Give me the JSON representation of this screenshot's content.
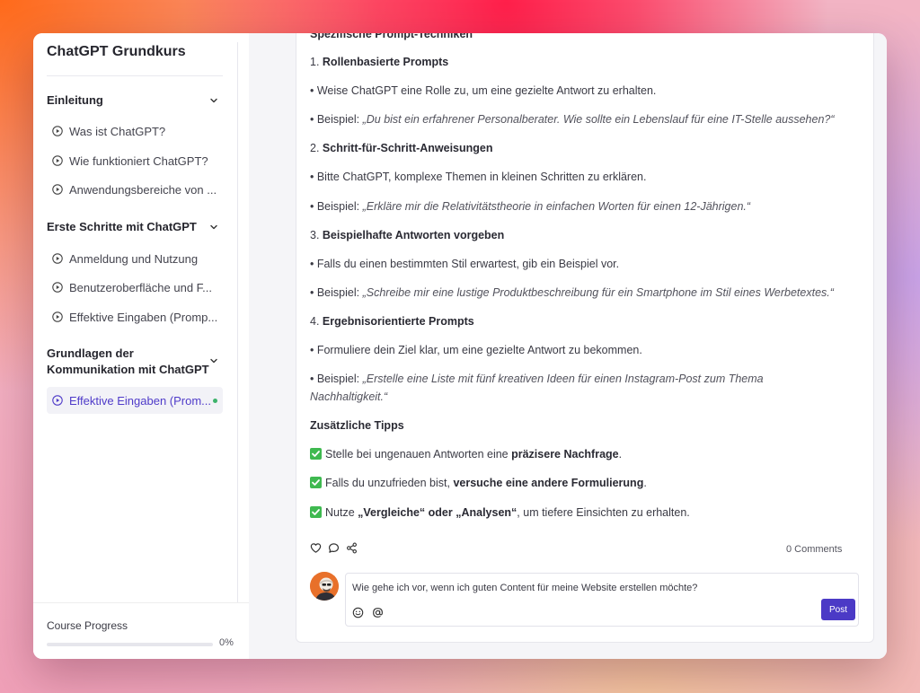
{
  "sidebar": {
    "course_title": "ChatGPT Grundkurs",
    "sections": [
      {
        "title": "Einleitung",
        "items": [
          "Was ist ChatGPT?",
          "Wie funktioniert ChatGPT?",
          "Anwendungsbereiche von ..."
        ]
      },
      {
        "title": "Erste Schritte mit ChatGPT",
        "items": [
          "Anmeldung und Nutzung",
          "Benutzeroberfläche und F...",
          "Effektive Eingaben (Promp..."
        ]
      },
      {
        "title_line1": "Grundlagen der",
        "title_line2": "Kommunikation mit ChatGPT",
        "items": [
          "Effektive Eingaben (Prom..."
        ]
      }
    ],
    "progress": {
      "label": "Course Progress",
      "percent_text": "0%",
      "value": 0
    }
  },
  "content": {
    "cut_heading": "Spezifische Prompt-Techniken",
    "s1": {
      "num": "1. ",
      "title": "Rollenbasierte Prompts"
    },
    "s1_bullet": "• Weise ChatGPT eine Rolle zu, um eine gezielte Antwort zu erhalten.",
    "s1_example_prefix": "• Beispiel: ",
    "s1_example": "„Du bist ein erfahrener Personalberater. Wie sollte ein Lebenslauf für eine IT-Stelle aussehen?“",
    "s2": {
      "num": "2. ",
      "title": "Schritt-für-Schritt-Anweisungen"
    },
    "s2_bullet": "• Bitte ChatGPT, komplexe Themen in kleinen Schritten zu erklären.",
    "s2_example_prefix": "• Beispiel: ",
    "s2_example": "„Erkläre mir die Relativitätstheorie in einfachen Worten für einen 12-Jährigen.“",
    "s3": {
      "num": "3. ",
      "title": "Beispielhafte Antworten vorgeben"
    },
    "s3_bullet": "• Falls du einen bestimmten Stil erwartest, gib ein Beispiel vor.",
    "s3_example_prefix": "• Beispiel: ",
    "s3_example": "„Schreibe mir eine lustige Produktbeschreibung für ein Smartphone im Stil eines Werbetextes.“",
    "s4": {
      "num": "4. ",
      "title": "Ergebnisorientierte Prompts"
    },
    "s4_bullet": "• Formuliere dein Ziel klar, um eine gezielte Antwort zu bekommen.",
    "s4_example_prefix": "• Beispiel: ",
    "s4_example_line1": "„Erstelle eine Liste mit fünf kreativen Ideen für einen Instagram-Post zum Thema",
    "s4_example_line2": "Nachhaltigkeit.“",
    "tips_heading": "Zusätzliche Tipps",
    "tip1": {
      "pre": "Stelle bei ungenauen Antworten eine ",
      "bold": "präzisere Nachfrage",
      "post": "."
    },
    "tip2": {
      "pre": "Falls du unzufrieden bist, ",
      "bold": "versuche eine andere Formulierung",
      "post": "."
    },
    "tip3": {
      "pre": "Nutze ",
      "bold": "„Vergleiche“ oder „Analysen“",
      "post": ", um tiefere Einsichten zu erhalten."
    }
  },
  "actions": {
    "comments_count": "0 Comments"
  },
  "comment": {
    "input_text": "Wie gehe ich vor, wenn ich guten Content für meine Website erstellen möchte?",
    "post_label": "Post"
  },
  "colors": {
    "accent": "#4b3ac6",
    "active_text": "#4f3bc9",
    "check": "#3fb950",
    "status_dot": "#3db36b"
  }
}
